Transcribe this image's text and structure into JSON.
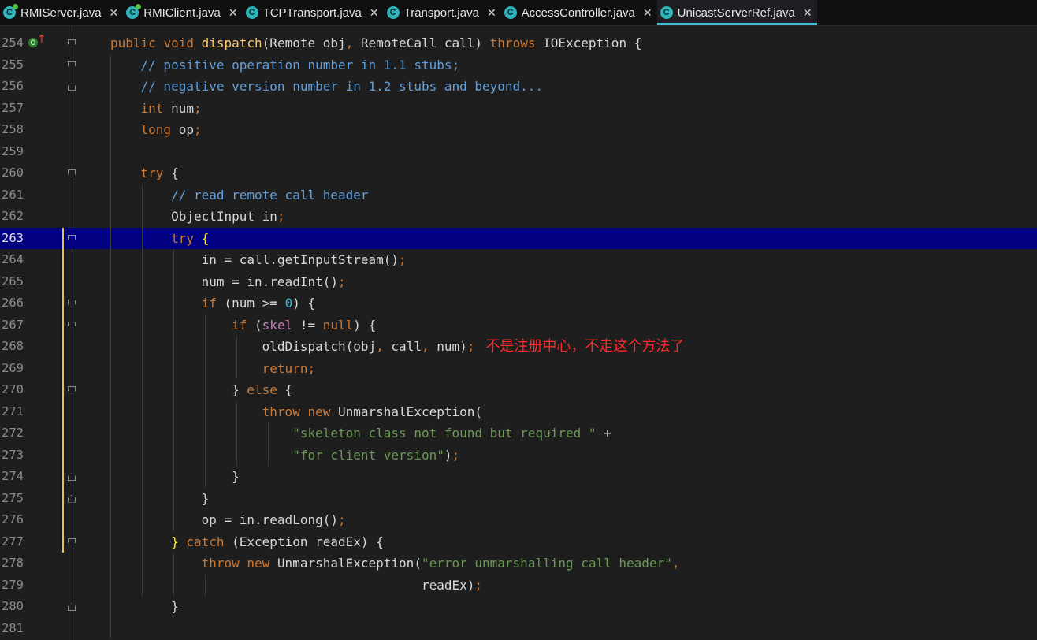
{
  "tabs": [
    {
      "label": "RMIServer.java",
      "close": "✕",
      "icon": "class-icon",
      "badge": true
    },
    {
      "label": "RMIClient.java",
      "close": "✕",
      "icon": "class-icon",
      "badge": true
    },
    {
      "label": "TCPTransport.java",
      "close": "✕",
      "icon": "class-icon",
      "badge": false
    },
    {
      "label": "Transport.java",
      "close": "✕",
      "icon": "abstract-class-icon",
      "badge": false
    },
    {
      "label": "AccessController.java",
      "close": "✕",
      "icon": "class-icon",
      "badge": false
    },
    {
      "label": "UnicastServerRef.java",
      "close": "✕",
      "icon": "class-icon",
      "badge": false,
      "active": true
    }
  ],
  "editor": {
    "current_line": "263",
    "annotation": "不是注册中心，不走这个方法了",
    "lines": [
      {
        "n": "254",
        "html_key": "l254"
      },
      {
        "n": "255",
        "html_key": "l255"
      },
      {
        "n": "256",
        "html_key": "l256"
      },
      {
        "n": "257",
        "html_key": "l257"
      },
      {
        "n": "258",
        "html_key": "l258"
      },
      {
        "n": "259",
        "html_key": "l259"
      },
      {
        "n": "260",
        "html_key": "l260"
      },
      {
        "n": "261",
        "html_key": "l261"
      },
      {
        "n": "262",
        "html_key": "l262"
      },
      {
        "n": "263",
        "html_key": "l263"
      },
      {
        "n": "264",
        "html_key": "l264"
      },
      {
        "n": "265",
        "html_key": "l265"
      },
      {
        "n": "266",
        "html_key": "l266"
      },
      {
        "n": "267",
        "html_key": "l267"
      },
      {
        "n": "268",
        "html_key": "l268"
      },
      {
        "n": "269",
        "html_key": "l269"
      },
      {
        "n": "270",
        "html_key": "l270"
      },
      {
        "n": "271",
        "html_key": "l271"
      },
      {
        "n": "272",
        "html_key": "l272"
      },
      {
        "n": "273",
        "html_key": "l273"
      },
      {
        "n": "274",
        "html_key": "l274"
      },
      {
        "n": "275",
        "html_key": "l275"
      },
      {
        "n": "276",
        "html_key": "l276"
      },
      {
        "n": "277",
        "html_key": "l277"
      },
      {
        "n": "278",
        "html_key": "l278"
      },
      {
        "n": "279",
        "html_key": "l279"
      },
      {
        "n": "280",
        "html_key": "l280"
      },
      {
        "n": "281",
        "html_key": "l281"
      }
    ],
    "code": {
      "l254": [
        [
          "kw",
          "public "
        ],
        [
          "kw",
          "void "
        ],
        [
          "fn",
          "dispatch"
        ],
        [
          "",
          "(Remote obj"
        ],
        [
          "punct",
          ", "
        ],
        [
          "",
          "RemoteCall call) "
        ],
        [
          "kw",
          "throws "
        ],
        [
          "",
          "IOException {"
        ]
      ],
      "l255": [
        [
          "cm",
          "    // positive operation number in 1.1 stubs;"
        ]
      ],
      "l256": [
        [
          "cm",
          "    // negative version number in 1.2 stubs and beyond..."
        ]
      ],
      "l257": [
        [
          "kw",
          "    int "
        ],
        [
          "",
          "num"
        ],
        [
          "punct",
          ";"
        ]
      ],
      "l258": [
        [
          "kw",
          "    long "
        ],
        [
          "",
          "op"
        ],
        [
          "punct",
          ";"
        ]
      ],
      "l259": [],
      "l260": [
        [
          "kw",
          "    try "
        ],
        [
          "",
          "{"
        ]
      ],
      "l261": [
        [
          "cm",
          "        // read remote call header"
        ]
      ],
      "l262": [
        [
          "",
          "        ObjectInput in"
        ],
        [
          "punct",
          ";"
        ]
      ],
      "l263": [
        [
          "kw",
          "        try "
        ],
        [
          "brace-hi",
          "{"
        ]
      ],
      "l264": [
        [
          "",
          "            in = call.getInputStream()"
        ],
        [
          "punct",
          ";"
        ]
      ],
      "l265": [
        [
          "",
          "            num = in.readInt()"
        ],
        [
          "punct",
          ";"
        ]
      ],
      "l266": [
        [
          "kw",
          "            if "
        ],
        [
          "",
          "(num >= "
        ],
        [
          "num",
          "0"
        ],
        [
          "",
          ") {"
        ]
      ],
      "l267": [
        [
          "kw",
          "                if "
        ],
        [
          "",
          "("
        ],
        [
          "field",
          "skel"
        ],
        [
          "",
          " != "
        ],
        [
          "kw",
          "null"
        ],
        [
          "",
          ") {"
        ]
      ],
      "l268": [
        [
          "",
          "                    oldDispatch(obj"
        ],
        [
          "punct",
          ", "
        ],
        [
          "",
          "call"
        ],
        [
          "punct",
          ", "
        ],
        [
          "",
          "num)"
        ],
        [
          "punct",
          ";"
        ]
      ],
      "l269": [
        [
          "kw",
          "                    return"
        ],
        [
          "punct",
          ";"
        ]
      ],
      "l270": [
        [
          "",
          "                } "
        ],
        [
          "kw",
          "else "
        ],
        [
          "",
          "{"
        ]
      ],
      "l271": [
        [
          "kw",
          "                    throw new "
        ],
        [
          "",
          "UnmarshalException("
        ]
      ],
      "l272": [
        [
          "st",
          "                        \"skeleton class not found but required \""
        ],
        [
          "",
          " +"
        ]
      ],
      "l273": [
        [
          "st",
          "                        \"for client version\""
        ],
        [
          "",
          ")"
        ],
        [
          "punct",
          ";"
        ]
      ],
      "l274": [
        [
          "",
          "                }"
        ]
      ],
      "l275": [
        [
          "",
          "            }"
        ]
      ],
      "l276": [
        [
          "",
          "            op = in.readLong()"
        ],
        [
          "punct",
          ";"
        ]
      ],
      "l277": [
        [
          "brace-hi",
          "        }"
        ],
        [
          "kw",
          " catch "
        ],
        [
          "",
          "(Exception readEx) {"
        ]
      ],
      "l278": [
        [
          "kw",
          "            throw new "
        ],
        [
          "",
          "UnmarshalException("
        ],
        [
          "st",
          "\"error unmarshalling call header\""
        ],
        [
          "punct",
          ","
        ]
      ],
      "l279": [
        [
          "",
          "                                         readEx)"
        ],
        [
          "punct",
          ";"
        ]
      ],
      "l280": [
        [
          "",
          "        }"
        ]
      ],
      "l281": []
    }
  },
  "icons": {
    "override_marker": "override-up-arrow-icon"
  }
}
